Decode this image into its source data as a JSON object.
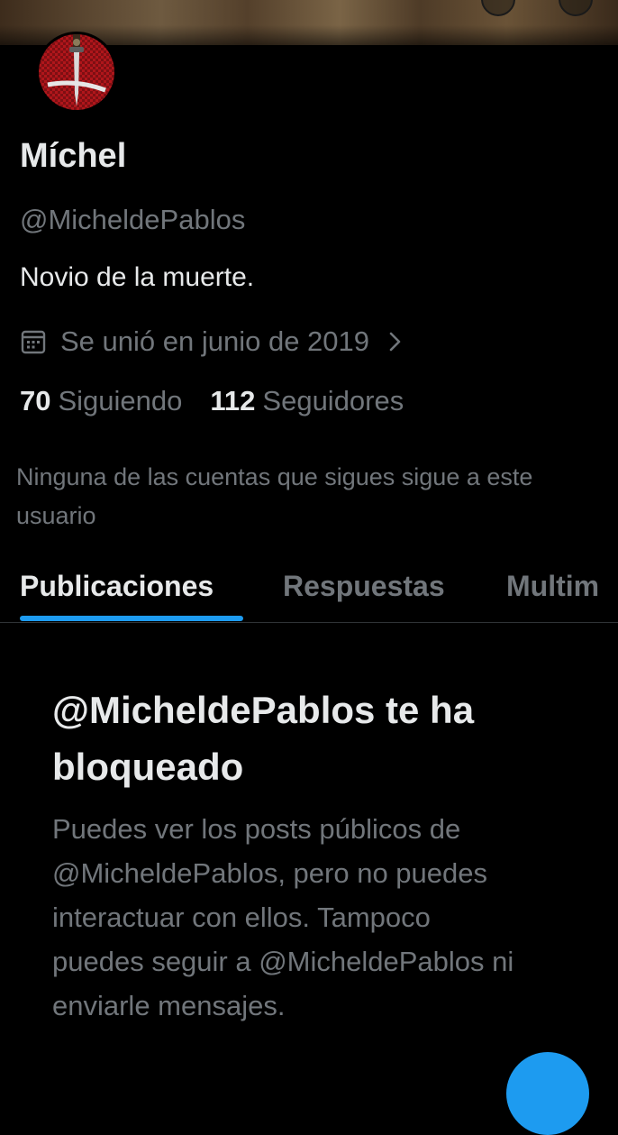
{
  "profile": {
    "name": "Míchel",
    "handle": "@MicheldePablos",
    "bio": "Novio de la muerte.",
    "joined": "Se unió en junio de 2019",
    "following_count": "70",
    "following_label": "Siguiendo",
    "followers_count": "112",
    "followers_label": "Seguidores",
    "mutuals_note": "Ninguna de las cuentas que sigues sigue a este usuario"
  },
  "tabs": [
    {
      "label": "Publicaciones",
      "active": true
    },
    {
      "label": "Respuestas",
      "active": false
    },
    {
      "label": "Multim",
      "active": false
    }
  ],
  "blocked": {
    "title": "@MicheldePablos te ha bloqueado",
    "body": "Puedes ver los posts públicos de @MicheldePablos, pero no puedes interactuar con ellos. Tampoco puedes seguir a @MicheldePablos ni enviarle mensajes."
  },
  "icons": {
    "joined": "calendar-icon",
    "joined_more": "chevron-right-icon",
    "fab": "compose-icon"
  },
  "colors": {
    "background": "#000000",
    "text_primary": "#e7e9ea",
    "text_secondary": "#71767b",
    "accent": "#1d9bf0",
    "divider": "#2f3336"
  }
}
